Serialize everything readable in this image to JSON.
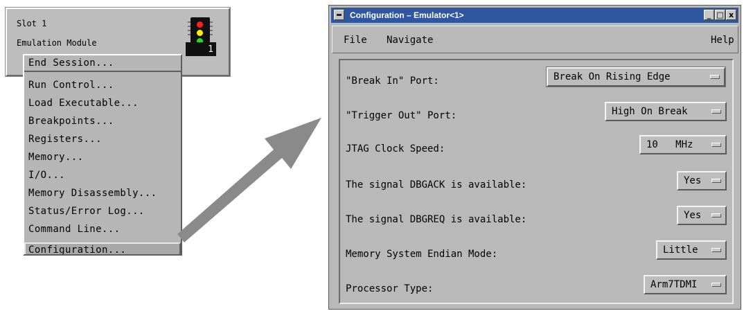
{
  "slot": {
    "title": "Slot 1",
    "subtitle": "Emulation Module",
    "chip_number": "1"
  },
  "context_menu": {
    "items": [
      "End Session...",
      "Run Control...",
      "Load Executable...",
      "Breakpoints...",
      "Registers...",
      "Memory...",
      "I/O...",
      "Memory Disassembly...",
      "Status/Error Log...",
      "Command Line...",
      "Configuration..."
    ],
    "selected": "Configuration..."
  },
  "window": {
    "title": "Configuration – Emulator<1>",
    "menu": {
      "file": "File",
      "navigate": "Navigate",
      "help": "Help"
    },
    "controls": {
      "minimize": "_",
      "maximize": "□",
      "close": "x"
    }
  },
  "settings": [
    {
      "label": "\"Break In\" Port:",
      "value": "Break On Rising Edge"
    },
    {
      "label": "\"Trigger Out\" Port:",
      "value": "High On Break"
    },
    {
      "label": "JTAG Clock Speed:",
      "value": "10   MHz"
    },
    {
      "label": "The signal DBGACK is available:",
      "value": "Yes"
    },
    {
      "label": "The signal DBGREQ is available:",
      "value": "Yes"
    },
    {
      "label": "Memory System Endian Mode:",
      "value": "Little"
    },
    {
      "label": "Processor Type:",
      "value": "Arm7TDMI"
    }
  ],
  "colors": {
    "title_bar": "#2f56a0",
    "panel_gray": "#b9b9b9",
    "led_red": "#ff2020",
    "led_yellow": "#ffee00",
    "led_green": "#22dd22",
    "arrow": "#8a8a8a"
  }
}
